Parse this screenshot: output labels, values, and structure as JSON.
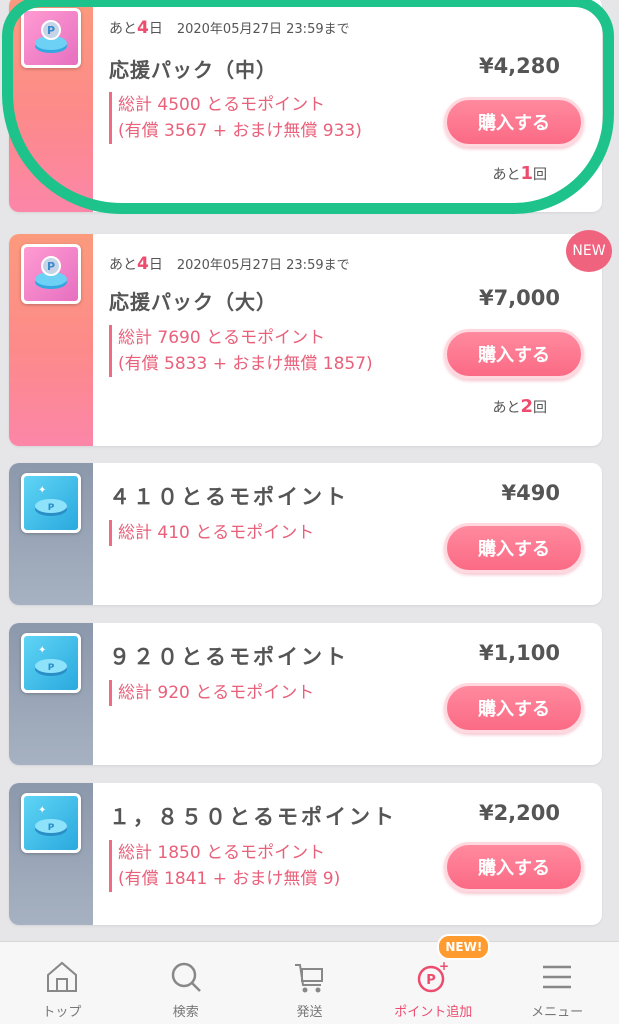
{
  "cards": [
    {
      "days_prefix": "あと",
      "days": "4",
      "days_suffix": "日",
      "deadline": "2020年05月27日 23:59まで",
      "title": "応援パック（中）",
      "price": "¥4,280",
      "desc1": "総計 4500 とるモポイント",
      "desc2": "(有償 3567 + おまけ無償 933)",
      "buy": "購入する",
      "remain_prefix": "あと",
      "remain": "1",
      "remain_suffix": "回"
    },
    {
      "days_prefix": "あと",
      "days": "4",
      "days_suffix": "日",
      "deadline": "2020年05月27日 23:59まで",
      "title": "応援パック（大）",
      "price": "¥7,000",
      "desc1": "総計 7690 とるモポイント",
      "desc2": "(有償 5833 + おまけ無償 1857)",
      "buy": "購入する",
      "remain_prefix": "あと",
      "remain": "2",
      "remain_suffix": "回",
      "badge": "NEW"
    },
    {
      "title": "４１０とるモポイント",
      "price": "¥490",
      "desc1": "総計 410 とるモポイント",
      "buy": "購入する"
    },
    {
      "title": "９２０とるモポイント",
      "price": "¥1,100",
      "desc1": "総計 920 とるモポイント",
      "buy": "購入する"
    },
    {
      "title": "１，８５０とるモポイント",
      "price": "¥2,200",
      "desc1": "総計 1850 とるモポイント",
      "desc2": "(有償 1841 + おまけ無償 9)",
      "buy": "購入する"
    }
  ],
  "nav": {
    "items": [
      {
        "label": "トップ",
        "icon": "home-icon"
      },
      {
        "label": "検索",
        "icon": "search-icon"
      },
      {
        "label": "発送",
        "icon": "cart-icon"
      },
      {
        "label": "ポイント追加",
        "icon": "point-add-icon",
        "badge": "NEW!"
      },
      {
        "label": "メニュー",
        "icon": "menu-icon"
      }
    ]
  },
  "colors": {
    "accent": "#ee4c6e",
    "button": "#fb6a85",
    "highlight": "#1dc38a",
    "background": "#e6e6e8"
  }
}
